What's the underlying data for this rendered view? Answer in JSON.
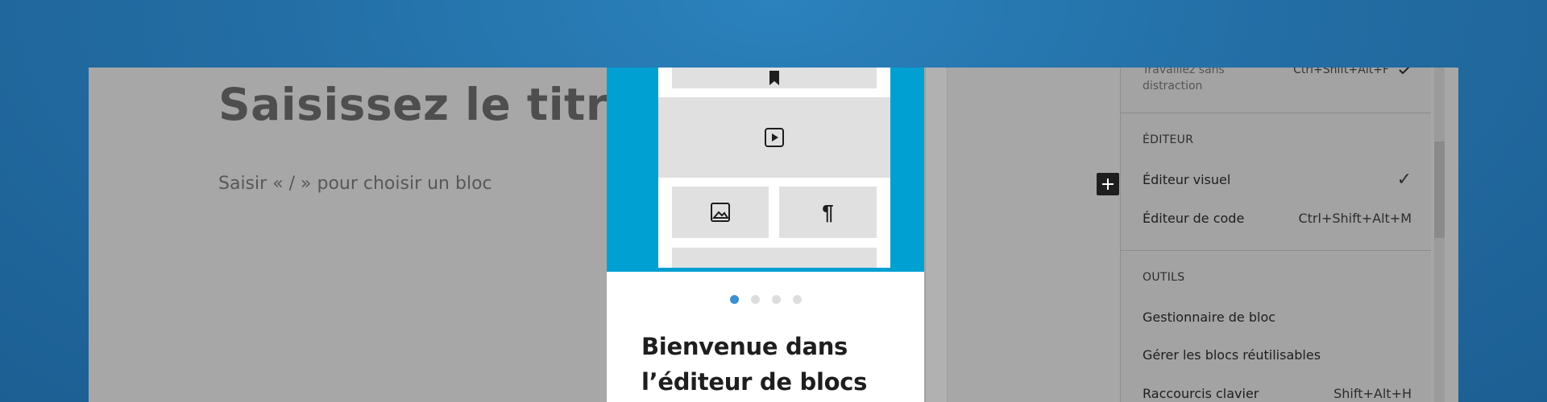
{
  "editor": {
    "title_placeholder": "Saisissez le titre",
    "block_placeholder": "Saisir « / » pour choisir un bloc",
    "inserter_icon": "plus-icon"
  },
  "welcome_guide": {
    "hero_color": "#00a0d2",
    "icons": [
      "bookmark-icon",
      "play-icon",
      "image-icon",
      "paragraph-icon"
    ],
    "paragraph_glyph": "¶",
    "pages": 4,
    "current_page": 1,
    "heading": "Bienvenue dans l’éditeur de blocs"
  },
  "options_menu": {
    "distraction_free": {
      "label": "Travaillez sans distraction",
      "shortcut": "Ctrl+Shift+Alt+F"
    },
    "editor_section": {
      "title": "ÉDITEUR",
      "items": [
        {
          "label": "Éditeur visuel",
          "shortcut": "✓"
        },
        {
          "label": "Éditeur de code",
          "shortcut": "Ctrl+Shift+Alt+M"
        }
      ]
    },
    "tools_section": {
      "title": "OUTILS",
      "items": [
        {
          "label": "Gestionnaire de bloc",
          "shortcut": ""
        },
        {
          "label": "Gérer les blocs réutilisables",
          "shortcut": ""
        },
        {
          "label": "Raccourcis clavier",
          "shortcut": "Shift+Alt+H"
        }
      ]
    }
  }
}
